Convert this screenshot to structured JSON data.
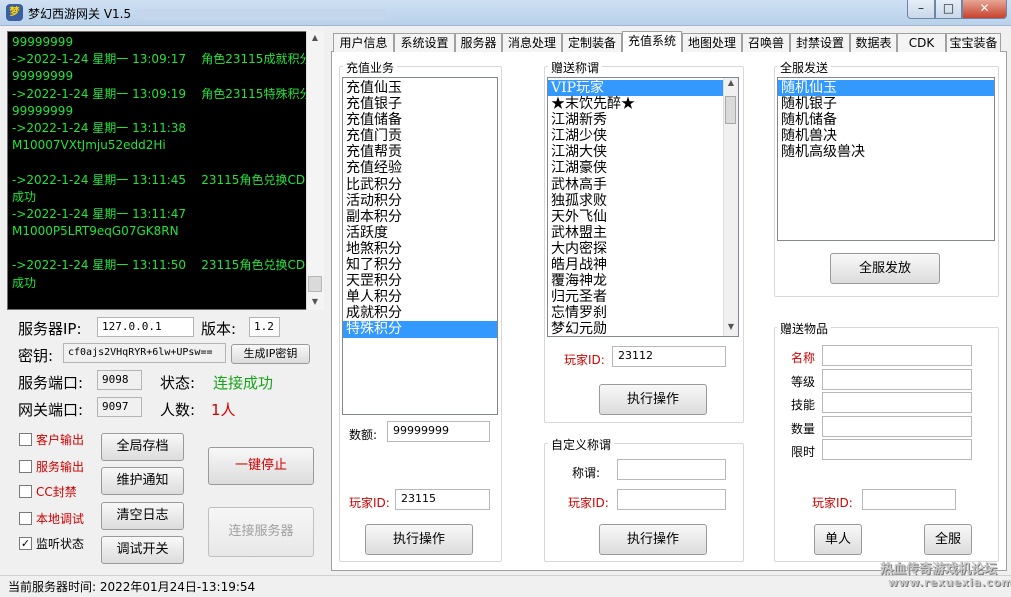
{
  "window": {
    "title": "梦幻西游网关 V1.5",
    "icon_text": "梦",
    "minimize_icon": "minimize-icon",
    "maximize_icon": "maximize-icon",
    "close_icon": "close-icon"
  },
  "log": {
    "lines": [
      "99999999",
      "->2022-1-24 星期一 13:09:17    角色23115成就积分",
      "99999999",
      "->2022-1-24 星期一 13:09:19    角色23115特殊积分",
      "99999999",
      "->2022-1-24 星期一 13:11:38",
      "M10007VXtJmju52edd2Hi",
      "",
      "->2022-1-24 星期一 13:11:45    23115角色兑换CDK",
      "成功",
      "->2022-1-24 星期一 13:11:47",
      "M1000P5LRT9eqG07GK8RN",
      "",
      "->2022-1-24 星期一 13:11:50    23115角色兑换CDK",
      "成功"
    ]
  },
  "server": {
    "ip_label": "服务器IP:",
    "ip_value": "127.0.0.1",
    "version_label": "版本:",
    "version_value": "1.2",
    "key_label": "密钥:",
    "key_value": "cf0ajs2VHqRYR+6lw+UPsw==",
    "gen_key_button": "生成IP密钥",
    "port_label": "服务端口:",
    "port_value": "9098",
    "status_label": "状态:",
    "status_value": "连接成功",
    "gateway_label": "网关端口:",
    "gateway_value": "9097",
    "count_label": "人数:",
    "count_value": "1人"
  },
  "options": [
    {
      "label": "客户输出",
      "checked": false,
      "red": true
    },
    {
      "label": "服务输出",
      "checked": false,
      "red": true
    },
    {
      "label": "CC封禁",
      "checked": false,
      "red": true
    },
    {
      "label": "本地调试",
      "checked": false,
      "red": true
    },
    {
      "label": "监听状态",
      "checked": true,
      "red": false
    }
  ],
  "buttons": {
    "save_all": "全局存档",
    "maintenance": "维护通知",
    "clear_log": "清空日志",
    "debug_toggle": "调试开关",
    "stop_all": "一键停止",
    "connect_server": "连接服务器"
  },
  "tabs": [
    "用户信息",
    "系统设置",
    "服务器",
    "消息处理",
    "定制装备",
    "充值系统",
    "地图处理",
    "召唤兽",
    "封禁设置",
    "数据表",
    "CDK",
    "宝宝装备"
  ],
  "active_tab": "充值系统",
  "recharge": {
    "title": "充值业务",
    "items": [
      "充值仙玉",
      "充值银子",
      "充值储备",
      "充值门贡",
      "充值帮贡",
      "充值经验",
      "比武积分",
      "活动积分",
      "副本积分",
      "活跃度",
      "地煞积分",
      "知了积分",
      "天罡积分",
      "单人积分",
      "成就积分",
      "特殊积分"
    ],
    "selected": "特殊积分",
    "amount_label": "数额:",
    "amount_value": "99999999",
    "player_label": "玩家ID:",
    "player_value": "23115",
    "execute_button": "执行操作"
  },
  "titles": {
    "title": "赠送称谓",
    "items": [
      "VIP玩家",
      "★末饮先醉★",
      "江湖新秀",
      "江湖少侠",
      "江湖大侠",
      "江湖豪侠",
      "武林高手",
      "独孤求败",
      "天外飞仙",
      "武林盟主",
      "大内密探",
      "皓月战神",
      "覆海神龙",
      "归元圣者",
      "忘情罗刹",
      "梦幻元勋"
    ],
    "selected": "VIP玩家",
    "player_label": "玩家ID:",
    "player_value": "23112",
    "execute_button": "执行操作"
  },
  "custom_title": {
    "title": "自定义称谓",
    "name_label": "称谓:",
    "name_value": "",
    "player_label": "玩家ID:",
    "player_value": "",
    "execute_button": "执行操作"
  },
  "broadcast": {
    "title": "全服发送",
    "items": [
      "随机仙玉",
      "随机银子",
      "随机储备",
      "随机兽决",
      "随机高级兽决"
    ],
    "selected": "随机仙玉",
    "send_button": "全服发放"
  },
  "gift": {
    "title": "赠送物品",
    "fields": [
      {
        "label": "名称",
        "value": "",
        "red": true
      },
      {
        "label": "等级",
        "value": "",
        "red": false
      },
      {
        "label": "技能",
        "value": "",
        "red": false
      },
      {
        "label": "数量",
        "value": "",
        "red": false
      },
      {
        "label": "限时",
        "value": "",
        "red": false
      }
    ],
    "player_label": "玩家ID:",
    "player_value": "",
    "single_button": "单人",
    "all_button": "全服"
  },
  "statusbar": {
    "text": "当前服务器时间:   2022年01月24日-13:19:54",
    "watermark_1": "热血传奇游戏机论坛",
    "watermark_2": "www.rexuexia.com"
  }
}
